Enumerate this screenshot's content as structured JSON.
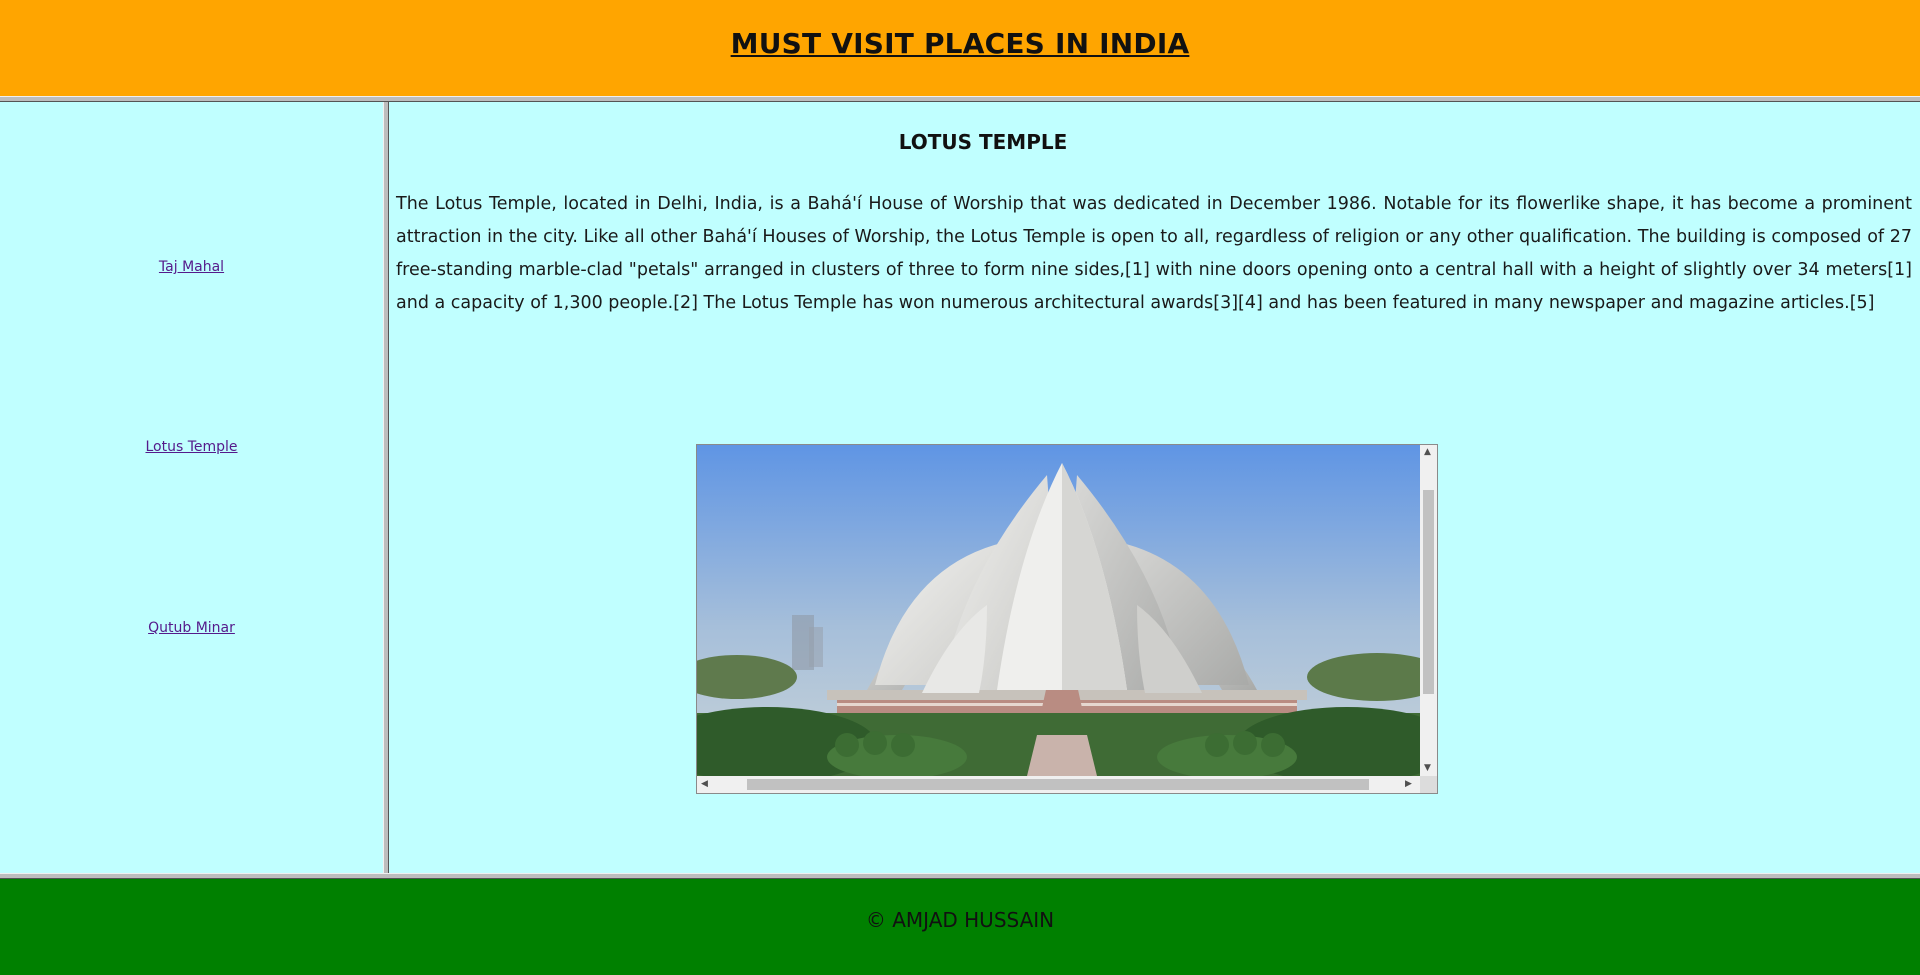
{
  "header": {
    "title": "MUST VISIT PLACES IN INDIA"
  },
  "sidebar": {
    "links": [
      {
        "label": "Taj Mahal"
      },
      {
        "label": "Lotus Temple"
      },
      {
        "label": "Qutub Minar"
      }
    ]
  },
  "main": {
    "heading": "LOTUS TEMPLE",
    "paragraph": "The Lotus Temple, located in Delhi, India, is a Bahá'í House of Worship that was dedicated in December 1986. Notable for its flowerlike shape, it has become a prominent attraction in the city. Like all other Bahá'í Houses of Worship, the Lotus Temple is open to all, regardless of religion or any other qualification. The building is composed of 27 free-standing marble-clad \"petals\" arranged in clusters of three to form nine sides,[1] with nine doors opening onto a central hall with a height of slightly over 34 meters[1] and a capacity of 1,300 people.[2] The Lotus Temple has won numerous architectural awards[3][4] and has been featured in many newspaper and magazine articles.[5]",
    "image": {
      "subject": "lotus-temple-photo"
    }
  },
  "footer": {
    "text": "© AMJAD HUSSAIN"
  },
  "colors": {
    "header_bg": "#ffa500",
    "content_bg": "#c0ffff",
    "footer_bg": "#008000",
    "link": "#551a8b"
  }
}
